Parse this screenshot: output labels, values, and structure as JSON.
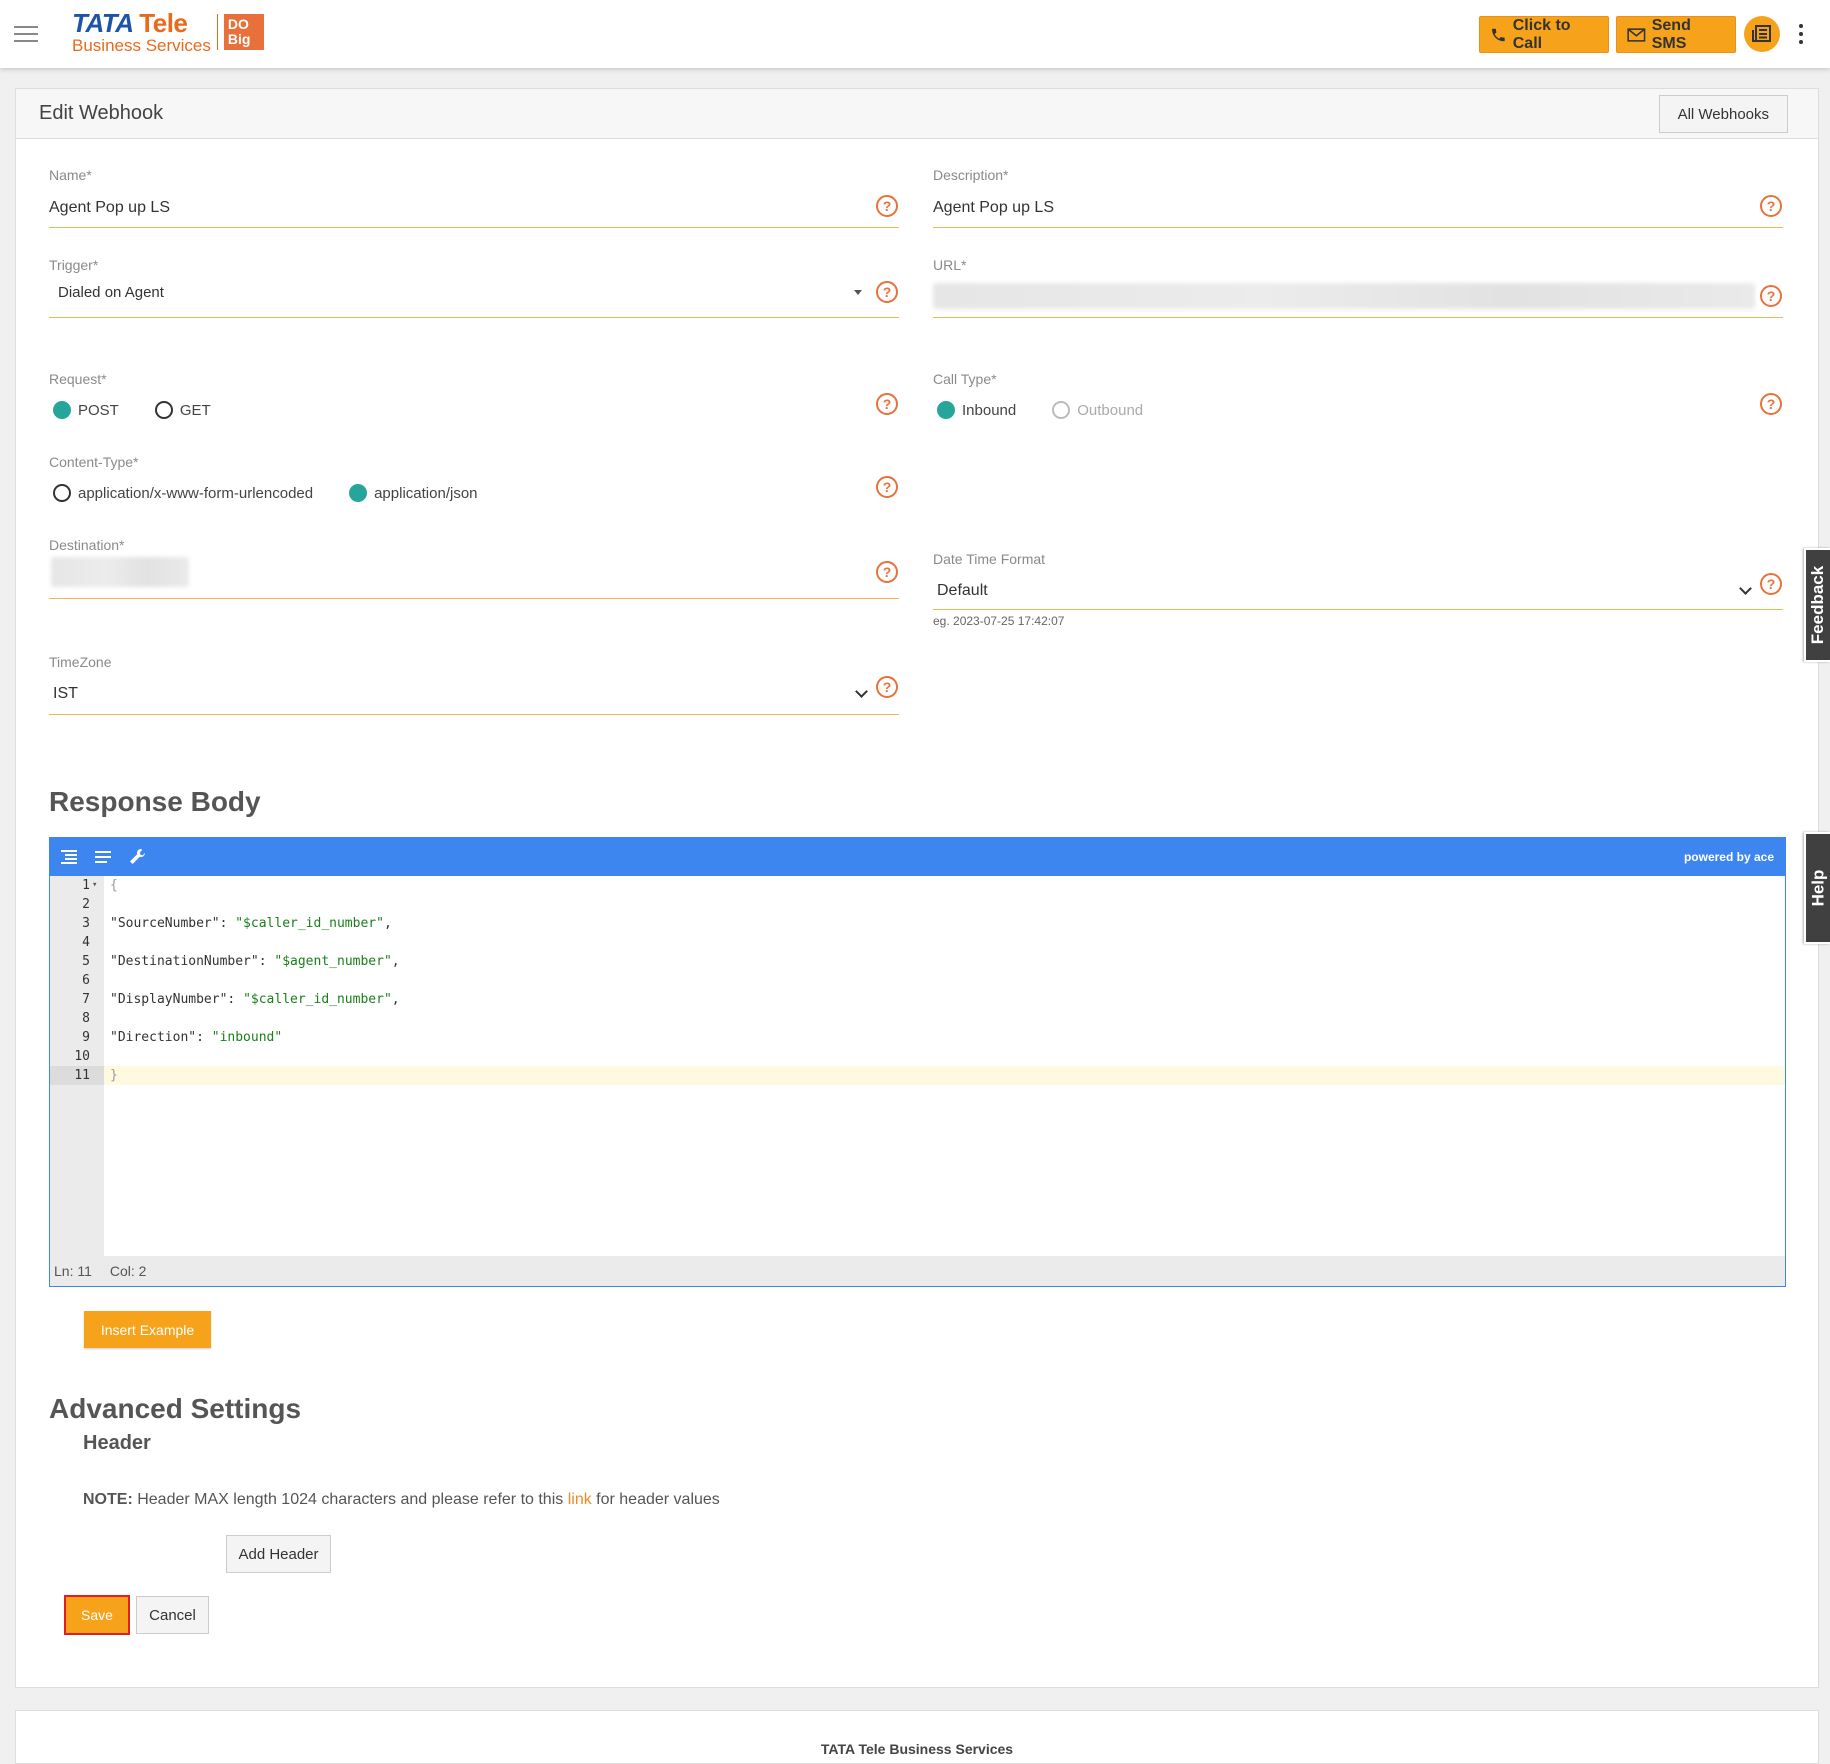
{
  "header": {
    "logo_brand": "TATA",
    "logo_tele": "Tele",
    "logo_sub": "Business Services",
    "logo_badge": "DO Big",
    "click_to_call": "Click to Call",
    "send_sms": "Send SMS"
  },
  "panel": {
    "title": "Edit Webhook",
    "all_webhooks": "All Webhooks"
  },
  "form": {
    "name_label": "Name*",
    "name_value": "Agent Pop up LS",
    "description_label": "Description*",
    "description_value": "Agent Pop up LS",
    "trigger_label": "Trigger*",
    "trigger_value": "Dialed on Agent",
    "url_label": "URL*",
    "request_label": "Request*",
    "request_options": [
      "POST",
      "GET"
    ],
    "call_type_label": "Call Type*",
    "call_type_options": [
      "Inbound",
      "Outbound"
    ],
    "content_type_label": "Content-Type*",
    "content_type_options": [
      "application/x-www-form-urlencoded",
      "application/json"
    ],
    "destination_label": "Destination*",
    "date_time_format_label": "Date Time Format",
    "date_time_format_value": "Default",
    "date_time_example": "eg. 2023-07-25 17:42:07",
    "timezone_label": "TimeZone",
    "timezone_value": "IST",
    "help_glyph": "?"
  },
  "response_body": {
    "title": "Response Body",
    "powered_by": "powered by ace",
    "lines": [
      {
        "n": "1",
        "text": "{"
      },
      {
        "n": "2",
        "text": ""
      },
      {
        "n": "3",
        "key": "\"SourceNumber\"",
        "sep": ": ",
        "val": "\"$caller_id_number\"",
        "tail": ","
      },
      {
        "n": "4",
        "text": ""
      },
      {
        "n": "5",
        "key": "\"DestinationNumber\"",
        "sep": ": ",
        "val": "\"$agent_number\"",
        "tail": ","
      },
      {
        "n": "6",
        "text": ""
      },
      {
        "n": "7",
        "key": "\"DisplayNumber\"",
        "sep": ": ",
        "val": "\"$caller_id_number\"",
        "tail": ","
      },
      {
        "n": "8",
        "text": ""
      },
      {
        "n": "9",
        "key": "\"Direction\"",
        "sep": ": ",
        "val": "\"inbound\"",
        "tail": ""
      },
      {
        "n": "10",
        "text": ""
      },
      {
        "n": "11",
        "text": "}"
      }
    ],
    "status_ln": "Ln: 11",
    "status_col": "Col: 2",
    "insert_example": "Insert Example"
  },
  "advanced": {
    "title": "Advanced Settings",
    "header_title": "Header",
    "note_bold": "NOTE:",
    "note_text": " Header MAX length 1024 characters and please refer to this ",
    "note_link": "link",
    "note_tail": " for header values",
    "add_header": "Add Header"
  },
  "actions": {
    "save": "Save",
    "cancel": "Cancel"
  },
  "side_tabs": {
    "feedback": "Feedback",
    "help": "Help"
  },
  "footer": {
    "text": "TATA Tele Business Services"
  },
  "colors": {
    "accent_orange": "#f7a21b",
    "radio_teal": "#26a69a",
    "editor_blue": "#3d86f0",
    "help_orange": "#e8733a"
  }
}
